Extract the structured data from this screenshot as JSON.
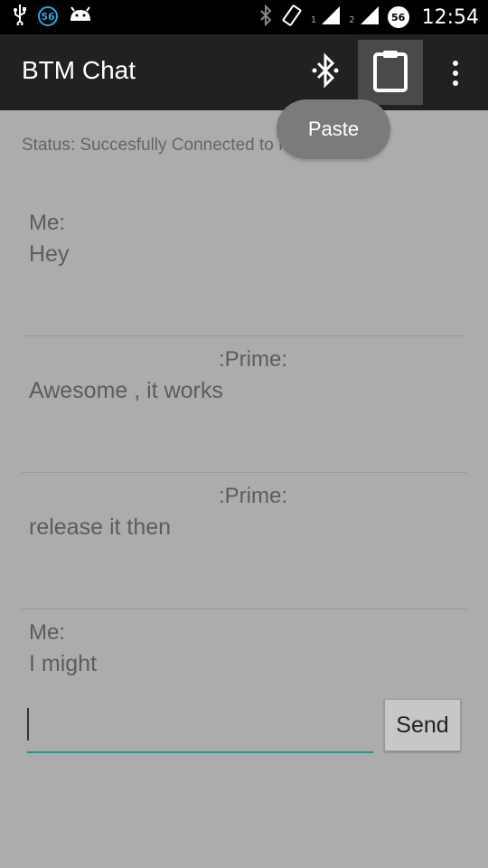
{
  "status_bar": {
    "badge_left": "56",
    "sim1": "1",
    "sim2": "2",
    "badge_right": "56",
    "time": "12:54"
  },
  "action_bar": {
    "title": "BTM Chat",
    "icons": [
      "bluetooth-icon",
      "clipboard-icon",
      "overflow-menu-icon"
    ]
  },
  "tooltip": {
    "label": "Paste"
  },
  "status_text": "Status: Succesfully Connected to Prime",
  "messages": [
    {
      "sender": "Me:",
      "text": "Hey"
    },
    {
      "sender": ":Prime:",
      "text": "Awesome , it works"
    },
    {
      "sender": ":Prime:",
      "text": "release it then"
    },
    {
      "sender": "Me:",
      "text": "I might"
    }
  ],
  "composer": {
    "value": "",
    "send_label": "Send"
  },
  "colors": {
    "background": "#acacac",
    "action_bar": "#212121",
    "accent": "#1a9a8e"
  }
}
